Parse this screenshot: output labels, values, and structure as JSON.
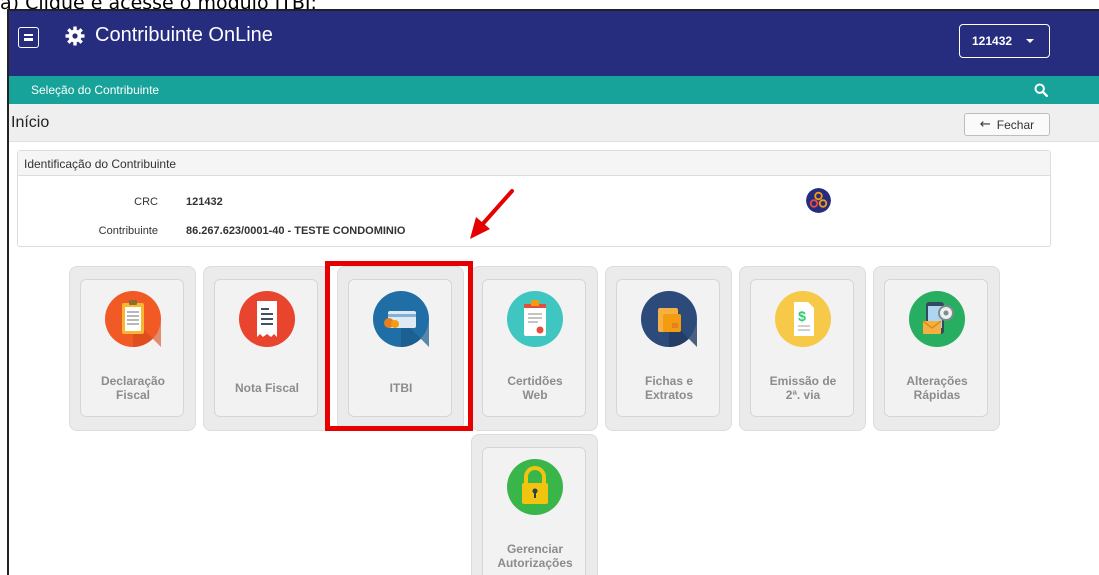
{
  "caption": "a)  Clique e acesse o módulo ITBI:",
  "header": {
    "menu_icon": "hamburger-icon",
    "gear_icon": "gear-icon",
    "title": "Contribuinte OnLine",
    "user_code": "121432"
  },
  "subnav": {
    "label": "Seleção do Contribuinte",
    "search_icon": "search-icon"
  },
  "page": {
    "title": "Início",
    "close_label": "Fechar"
  },
  "identification": {
    "heading": "Identificação do Contribuinte",
    "crc_label": "CRC",
    "crc_value": "121432",
    "taxpayer_label": "Contribuinte",
    "taxpayer_value": "86.267.623/0001-40 - TESTE CONDOMINIO"
  },
  "modules": [
    {
      "line1": "Declaração",
      "line2": "Fiscal",
      "icon": "clipboard-icon"
    },
    {
      "line1": "Nota Fiscal",
      "line2": "",
      "icon": "receipt-icon"
    },
    {
      "line1": "ITBI",
      "line2": "",
      "icon": "card-icon"
    },
    {
      "line1": "Certidões",
      "line2": "Web",
      "icon": "certificate-icon"
    },
    {
      "line1": "Fichas e",
      "line2": "Extratos",
      "icon": "folder-icon"
    },
    {
      "line1": "Emissão de",
      "line2": "2ª. via",
      "icon": "document-dollar-icon"
    },
    {
      "line1": "Alterações",
      "line2": "Rápidas",
      "icon": "settings-mail-icon"
    },
    {
      "line1": "Gerenciar",
      "line2": "Autorizações",
      "icon": "lock-icon"
    }
  ],
  "colors": {
    "navbar": "#262d7e",
    "subnav": "#18a39a",
    "highlight": "#e60000"
  }
}
